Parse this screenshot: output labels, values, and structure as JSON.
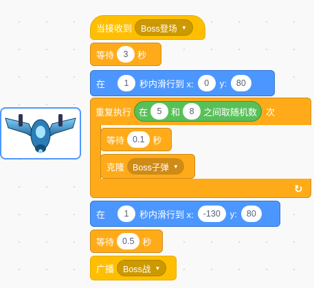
{
  "sprite": {
    "icon": "spaceship-icon"
  },
  "script": {
    "hat": {
      "label": "当接收到",
      "message": "Boss登场"
    },
    "wait1": {
      "label": "等待",
      "value": "3",
      "unit": "秒"
    },
    "glide1": {
      "prefix": "在",
      "secs": "1",
      "mid": "秒内滑行到 x:",
      "x": "0",
      "ylabel": "y:",
      "y": "80"
    },
    "repeat": {
      "label": "重复执行",
      "suffix": "次",
      "random": {
        "prefix": "在",
        "from": "5",
        "and": "和",
        "to": "8",
        "suffix": "之间取随机数"
      }
    },
    "wait2": {
      "label": "等待",
      "value": "0.1",
      "unit": "秒"
    },
    "clone": {
      "label": "克隆",
      "target": "Boss子弹"
    },
    "loop_arrow": "↻",
    "glide2": {
      "prefix": "在",
      "secs": "1",
      "mid": "秒内滑行到 x:",
      "x": "-130",
      "ylabel": "y:",
      "y": "80"
    },
    "wait3": {
      "label": "等待",
      "value": "0.5",
      "unit": "秒"
    },
    "broadcast": {
      "label": "广播",
      "message": "Boss战"
    }
  },
  "colors": {
    "event": "#ffbf00",
    "control": "#ffab19",
    "motion": "#4c97ff",
    "operator": "#59c059"
  }
}
